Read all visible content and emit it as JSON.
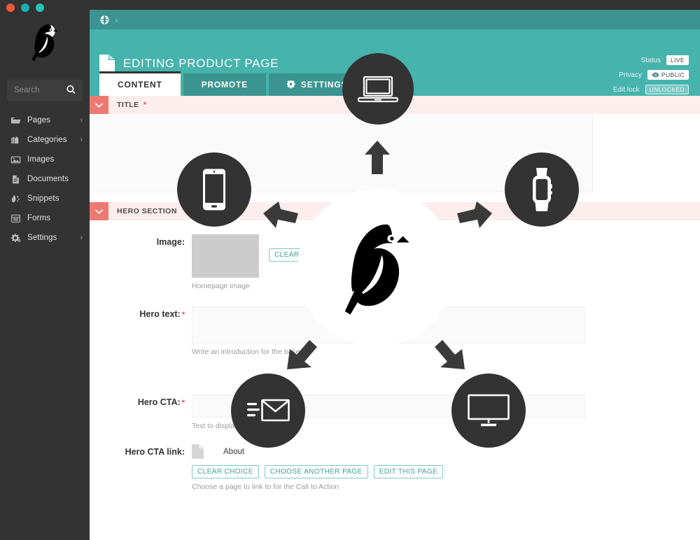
{
  "window": {
    "traffic_lights": [
      "close",
      "minimize",
      "zoom"
    ]
  },
  "sidebar": {
    "logo": "bird-logo",
    "search": {
      "placeholder": "Search",
      "value": "",
      "icon": "search-icon"
    },
    "items": [
      {
        "label": "Pages",
        "icon": "folder-icon",
        "has_chevron": true,
        "chevron": "›"
      },
      {
        "label": "Categories",
        "icon": "briefcase-icon",
        "has_chevron": true,
        "chevron": "›"
      },
      {
        "label": "Images",
        "icon": "image-icon",
        "has_chevron": false,
        "chevron": ""
      },
      {
        "label": "Documents",
        "icon": "document-icon",
        "has_chevron": false,
        "chevron": ""
      },
      {
        "label": "Snippets",
        "icon": "snippet-icon",
        "has_chevron": false,
        "chevron": ""
      },
      {
        "label": "Forms",
        "icon": "form-icon",
        "has_chevron": false,
        "chevron": ""
      },
      {
        "label": "Settings",
        "icon": "gear-icon",
        "has_chevron": true,
        "chevron": "›"
      }
    ]
  },
  "breadcrumb": {
    "home_icon": "globe-icon",
    "separator": "›"
  },
  "header": {
    "icon": "document-icon",
    "title": "EDITING PRODUCT PAGE",
    "meta": [
      {
        "label": "Status",
        "value": "LIVE",
        "style": "solid",
        "icon": ""
      },
      {
        "label": "Privacy",
        "value": "PUBLIC",
        "style": "solid",
        "icon": "eye-icon"
      },
      {
        "label": "Edit lock",
        "value": "UNLOCKED",
        "style": "ghost",
        "icon": ""
      }
    ]
  },
  "tabs": [
    {
      "label": "CONTENT",
      "active": true,
      "icon": ""
    },
    {
      "label": "PROMOTE",
      "active": false,
      "icon": ""
    },
    {
      "label": "SETTINGS",
      "active": false,
      "icon": "gear-icon"
    }
  ],
  "sections": [
    {
      "name": "title-section",
      "heading": "TITLE",
      "required": true,
      "required_mark": "*",
      "collapse_icon": "chevron-down-icon"
    },
    {
      "name": "hero-section",
      "heading": "HERO SECTION",
      "required": false,
      "required_mark": "",
      "collapse_icon": "chevron-down-icon"
    }
  ],
  "fields": {
    "image": {
      "label": "Image:",
      "required": false,
      "required_mark": "",
      "thumbnail_alt": "image-placeholder",
      "clear_button": "CLEAR CHOICE",
      "help": "Homepage image"
    },
    "hero_text": {
      "label": "Hero text:",
      "required": true,
      "required_mark": "*",
      "value": "",
      "help": "Write an introduction for the bakery"
    },
    "hero_cta": {
      "label": "Hero CTA:",
      "required": true,
      "required_mark": "*",
      "value": "",
      "help": "Text to display on the button"
    },
    "hero_cta_link": {
      "label": "Hero CTA link:",
      "required": false,
      "required_mark": "",
      "chip_icon": "document-icon",
      "chip_name": "About",
      "buttons": [
        "CLEAR CHOICE",
        "CHOOSE ANOTHER PAGE",
        "EDIT THIS PAGE"
      ],
      "clear_button": "CLEAR CHOICE",
      "choose_button": "CHOOSE ANOTHER PAGE",
      "edit_button": "EDIT THIS PAGE",
      "help": "Choose a page to link to for the Call to Action"
    }
  },
  "overlay": {
    "center_logo": "bird-logo",
    "devices": [
      {
        "name": "laptop",
        "icon": "laptop-icon"
      },
      {
        "name": "phone",
        "icon": "mobile-phone-icon"
      },
      {
        "name": "smartwatch",
        "icon": "smartwatch-icon"
      },
      {
        "name": "email",
        "icon": "email-icon"
      },
      {
        "name": "desktop",
        "icon": "desktop-monitor-icon"
      }
    ],
    "arrows": [
      "up",
      "left",
      "right",
      "down-left",
      "down-right"
    ]
  },
  "colors": {
    "teal": "#46b3ad",
    "teal_dark": "#3c9490",
    "sidebar": "#333333",
    "coral": "#ed7a72",
    "coral_light": "#fbeeed",
    "accent_link": "#3d9f9a",
    "required": "#e8554a"
  }
}
